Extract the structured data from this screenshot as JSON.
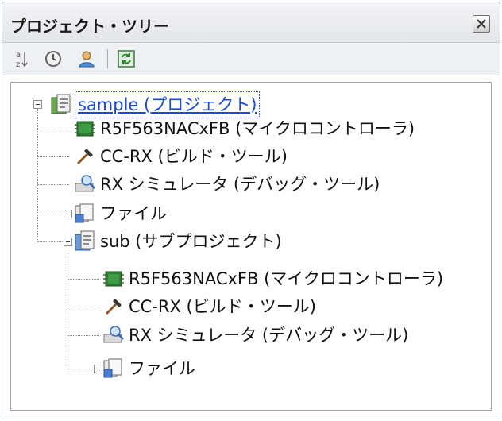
{
  "panel": {
    "title": "プロジェクト・ツリー",
    "close_icon": "close-icon"
  },
  "toolbar": {
    "buttons": [
      {
        "name": "sort-icon"
      },
      {
        "name": "clock-icon"
      },
      {
        "name": "user-icon"
      },
      {
        "name": "refresh-icon"
      }
    ]
  },
  "tree": {
    "project": {
      "label": "sample (プロジェクト)",
      "expanded": true,
      "children": {
        "mcu": "R5F563NACxFB (マイクロコントローラ)",
        "build_tool": "CC-RX (ビルド・ツール)",
        "debug_tool": "RX シミュレータ (デバッグ・ツール)",
        "files": "ファイル"
      }
    },
    "subproject": {
      "label": "sub (サブプロジェクト)",
      "expanded": true,
      "children": {
        "mcu": "R5F563NACxFB (マイクロコントローラ)",
        "build_tool": "CC-RX (ビルド・ツール)",
        "debug_tool": "RX シミュレータ (デバッグ・ツール)",
        "files": "ファイル"
      }
    }
  },
  "colors": {
    "selection_text": "#1a4bd1",
    "frame_border": "#9aa3ae"
  }
}
